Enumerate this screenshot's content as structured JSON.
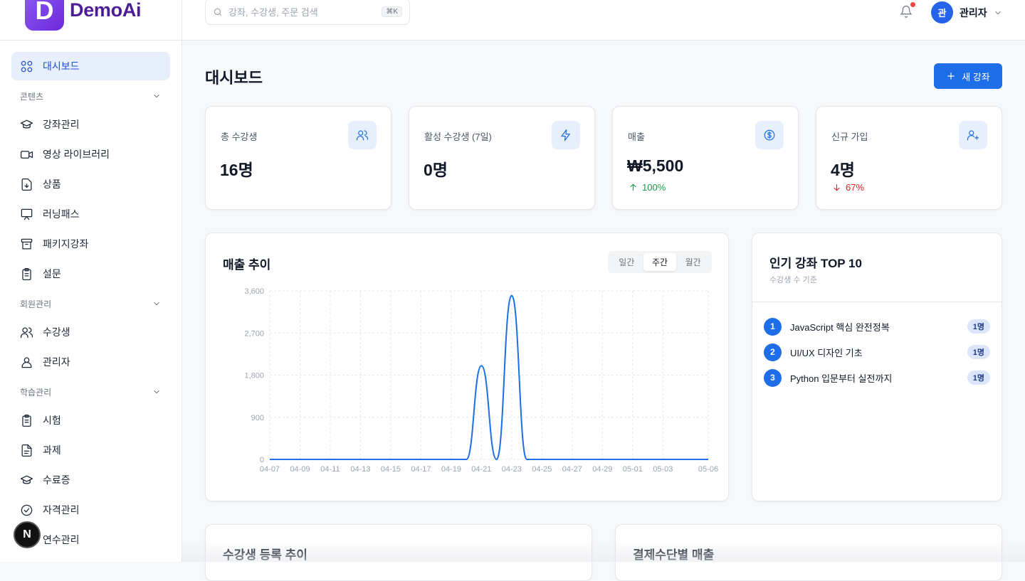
{
  "brand": {
    "logo_letter": "D",
    "name": "DemoAi",
    "accent": "#1d6ee8"
  },
  "search": {
    "placeholder": "강좌, 수강생, 주문 검색",
    "shortcut": "⌘K"
  },
  "user": {
    "avatar_initial": "관",
    "name": "관리자"
  },
  "sidebar": {
    "dashboard": "대시보드",
    "sections": [
      {
        "label": "콘텐츠",
        "items": [
          {
            "label": "강좌관리",
            "icon": "graduation-cap-icon"
          },
          {
            "label": "영상 라이브러리",
            "icon": "video-icon"
          },
          {
            "label": "상품",
            "icon": "file-download-icon"
          },
          {
            "label": "러닝패스",
            "icon": "presentation-icon"
          },
          {
            "label": "패키지강좌",
            "icon": "archive-icon"
          },
          {
            "label": "설문",
            "icon": "clipboard-icon"
          }
        ]
      },
      {
        "label": "회원관리",
        "items": [
          {
            "label": "수강생",
            "icon": "users-icon"
          },
          {
            "label": "관리자",
            "icon": "user-icon"
          }
        ]
      },
      {
        "label": "학습관리",
        "items": [
          {
            "label": "시험",
            "icon": "clipboard-icon"
          },
          {
            "label": "과제",
            "icon": "file-text-icon"
          },
          {
            "label": "수료증",
            "icon": "graduation-cap-icon"
          },
          {
            "label": "자격관리",
            "icon": "check-circle-icon"
          },
          {
            "label": "연수관리",
            "icon": "graduation-cap-icon"
          }
        ]
      }
    ]
  },
  "page": {
    "title": "대시보드",
    "new_button": "새 강좌"
  },
  "stats": [
    {
      "label": "총 수강생",
      "value": "16명",
      "icon": "users-icon",
      "change": "",
      "direction": ""
    },
    {
      "label": "활성 수강생 (7일)",
      "value": "0명",
      "icon": "zap-icon",
      "change": "",
      "direction": ""
    },
    {
      "label": "매출",
      "value": "₩5,500",
      "icon": "dollar-icon",
      "change": "100%",
      "direction": "up"
    },
    {
      "label": "신규 가입",
      "value": "4명",
      "icon": "user-plus-icon",
      "change": "67%",
      "direction": "down"
    }
  ],
  "revenue_chart": {
    "title": "매출 추이",
    "periods": [
      "일간",
      "주간",
      "월간"
    ],
    "selected_period": "주간"
  },
  "chart_data": {
    "type": "line",
    "title": "매출 추이",
    "xlabel": "",
    "ylabel": "",
    "x_ticks": [
      "04-07",
      "04-09",
      "04-11",
      "04-13",
      "04-15",
      "04-17",
      "04-19",
      "04-21",
      "04-23",
      "04-25",
      "04-27",
      "04-29",
      "05-01",
      "05-03",
      "05-06"
    ],
    "y_ticks": [
      "0",
      "900",
      "1,800",
      "2,700",
      "3,600"
    ],
    "ylim": [
      0,
      3600
    ],
    "grid": true,
    "series": [
      {
        "x": [
          "04-07",
          "04-09",
          "04-11",
          "04-13",
          "04-15",
          "04-17",
          "04-19",
          "04-20",
          "04-21",
          "04-22",
          "04-23",
          "04-24",
          "04-25",
          "04-27",
          "04-29",
          "05-01",
          "05-03",
          "05-06"
        ],
        "values": [
          0,
          0,
          0,
          0,
          0,
          0,
          0,
          0,
          2000,
          0,
          3500,
          0,
          0,
          0,
          0,
          0,
          0,
          0
        ],
        "color": "#1d6ee8"
      }
    ]
  },
  "top_courses": {
    "title": "인기 강좌 TOP 10",
    "subtitle": "수강생 수 기준",
    "items": [
      {
        "rank": "1",
        "name": "JavaScript 핵심 완전정복",
        "count": "1명"
      },
      {
        "rank": "2",
        "name": "UI/UX 디자인 기초",
        "count": "1명"
      },
      {
        "rank": "3",
        "name": "Python 입문부터 실전까지",
        "count": "1명"
      }
    ]
  },
  "bottom_cards": {
    "enrollment_title": "수강생 등록 추이",
    "payment_title": "결제수단별 매출"
  },
  "next_badge": "N"
}
